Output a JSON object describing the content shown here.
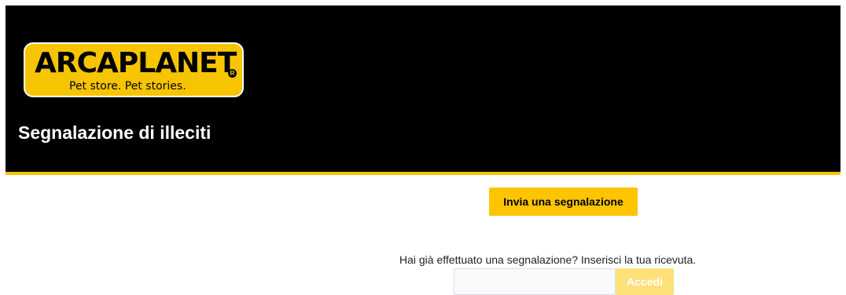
{
  "header": {
    "logo": {
      "brand": "ARCAPLANET",
      "registered_mark": "R",
      "tagline": "Pet store. Pet stories."
    },
    "title": "Segnalazione di illeciti"
  },
  "main": {
    "submit_report_label": "Invia una segnalazione",
    "receipt_prompt": "Hai già effettuato una segnalazione? Inserisci la tua ricevuta.",
    "receipt_input_value": "",
    "login_label": "Accedi"
  },
  "colors": {
    "header_bg": "#000000",
    "accent": "#ffc400",
    "accent_disabled": "#ffe17a"
  }
}
